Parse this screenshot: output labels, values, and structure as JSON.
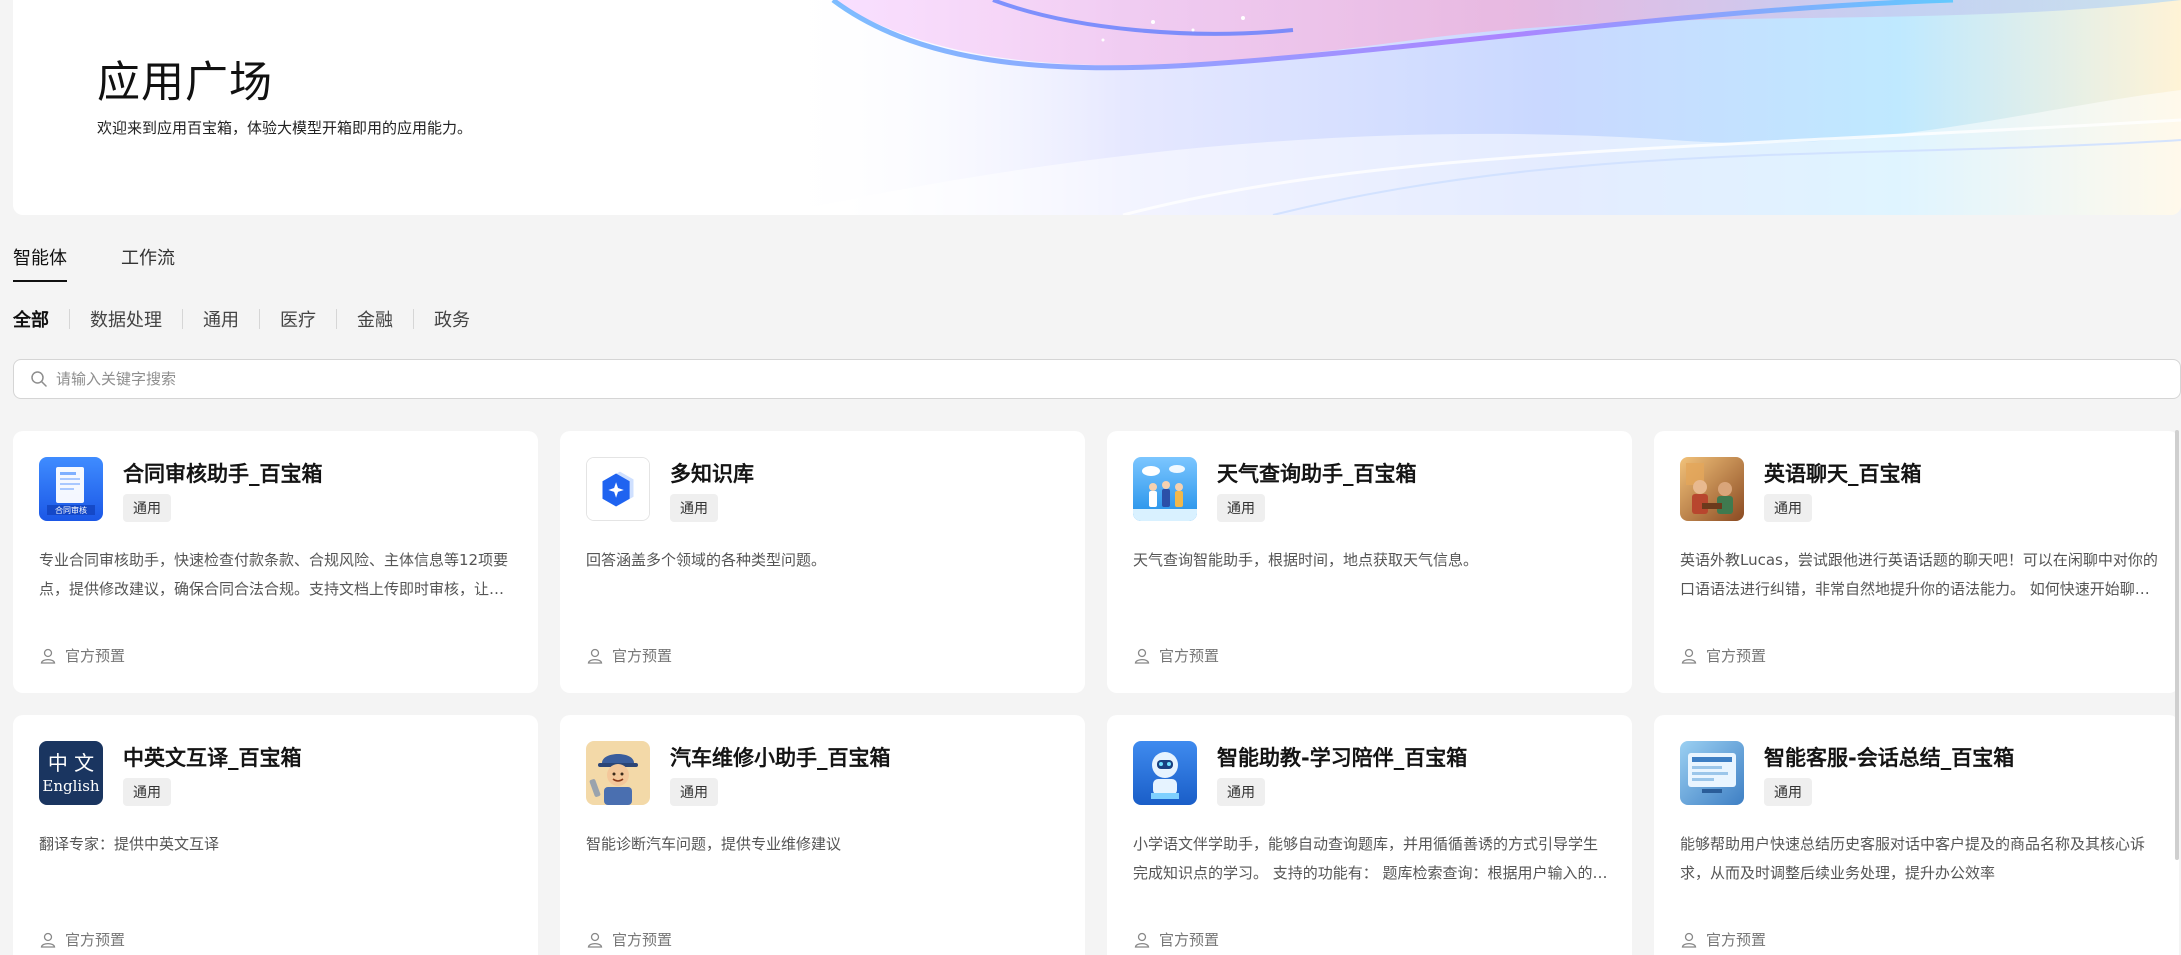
{
  "hero": {
    "title": "应用广场",
    "subtitle": "欢迎来到应用百宝箱，体验大模型开箱即用的应用能力。"
  },
  "tabs": [
    {
      "label": "智能体",
      "active": true
    },
    {
      "label": "工作流",
      "active": false
    }
  ],
  "categories": [
    {
      "label": "全部",
      "active": true
    },
    {
      "label": "数据处理",
      "active": false
    },
    {
      "label": "通用",
      "active": false
    },
    {
      "label": "医疗",
      "active": false
    },
    {
      "label": "金融",
      "active": false
    },
    {
      "label": "政务",
      "active": false
    }
  ],
  "search": {
    "placeholder": "请输入关键字搜索",
    "icon": "search-icon"
  },
  "cards": [
    {
      "title": "合同审核助手_百宝箱",
      "tag": "通用",
      "icon": "contract-review-icon",
      "description": "专业合同审核助手，快速检查付款条款、合规风险、主体信息等12项要点，提供修改建议，确保合同合法合规。支持文档上传即时审核，让合同审查更高效。",
      "footer": "官方预置"
    },
    {
      "title": "多知识库",
      "tag": "通用",
      "icon": "knowledge-base-icon",
      "description": "回答涵盖多个领域的各种类型问题。",
      "footer": "官方预置"
    },
    {
      "title": "天气查询助手_百宝箱",
      "tag": "通用",
      "icon": "weather-icon",
      "description": "天气查询智能助手，根据时间，地点获取天气信息。",
      "footer": "官方预置"
    },
    {
      "title": "英语聊天_百宝箱",
      "tag": "通用",
      "icon": "english-chat-icon",
      "description": "英语外教Lucas，尝试跟他进行英语话题的聊天吧！可以在闲聊中对你的口语语法进行纠错，非常自然地提升你的语法能力。 如何快速开始聊天？",
      "footer": "官方预置"
    },
    {
      "title": "中英文互译_百宝箱",
      "tag": "通用",
      "icon": "translation-icon",
      "description": "翻译专家：提供中英文互译",
      "footer": "官方预置"
    },
    {
      "title": "汽车维修小助手_百宝箱",
      "tag": "通用",
      "icon": "mechanic-icon",
      "description": "智能诊断汽车问题，提供专业维修建议",
      "footer": "官方预置"
    },
    {
      "title": "智能助教-学习陪伴_百宝箱",
      "tag": "通用",
      "icon": "teaching-assistant-icon",
      "description": "小学语文伴学助手，能够自动查询题库，并用循循善诱的方式引导学生完成知识点的学习。 支持的功能有： 题库检索查询：根据用户输入的问题进行检索",
      "footer": "官方预置"
    },
    {
      "title": "智能客服-会话总结_百宝箱",
      "tag": "通用",
      "icon": "customer-service-icon",
      "description": "能够帮助用户快速总结历史客服对话中客户提及的商品名称及其核心诉求，从而及时调整后续业务处理，提升办公效率",
      "footer": "官方预置"
    }
  ]
}
